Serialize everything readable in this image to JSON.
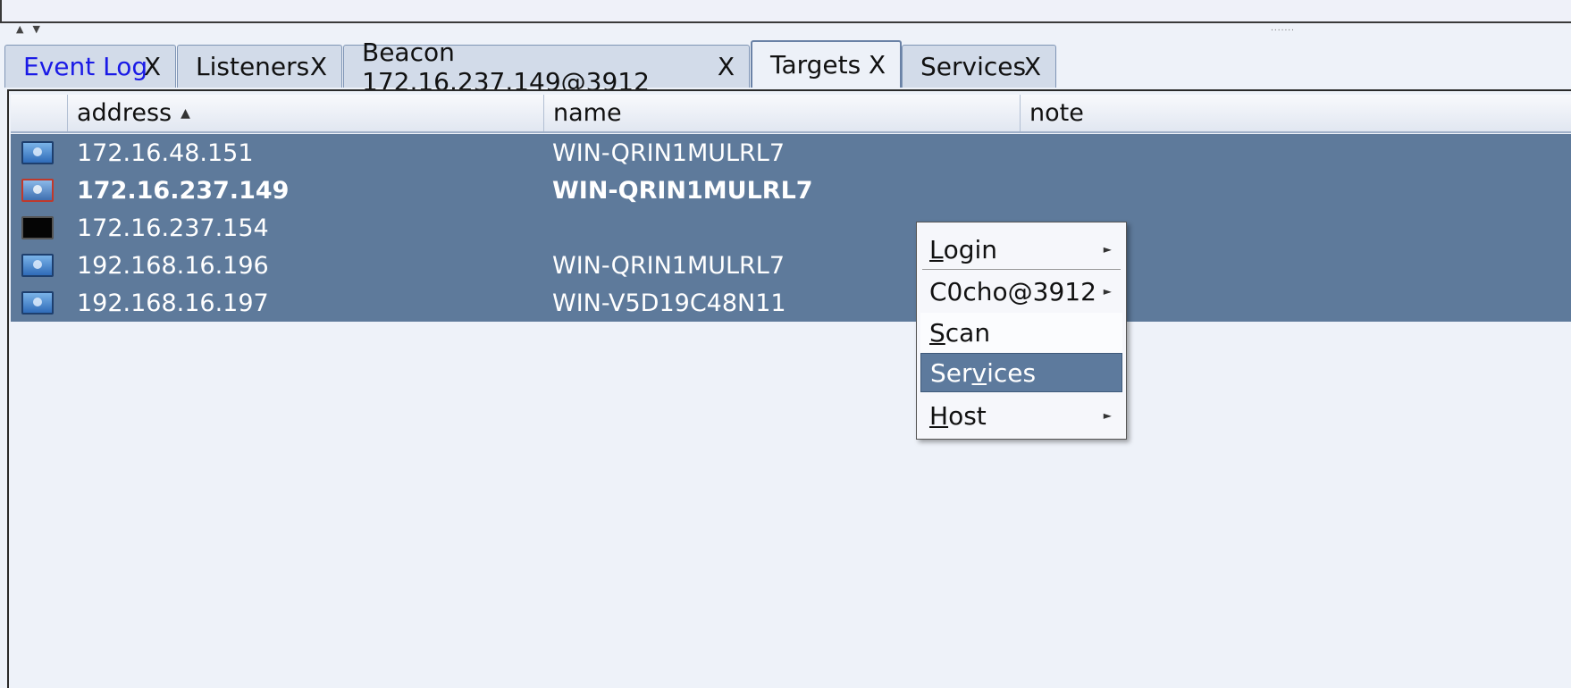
{
  "tabs": [
    {
      "label": "Event Log",
      "close": "X"
    },
    {
      "label": "Listeners",
      "close": "X"
    },
    {
      "label": "Beacon 172.16.237.149@3912",
      "close": "X"
    },
    {
      "label": "Targets",
      "close": "X"
    },
    {
      "label": "Services",
      "close": "X"
    }
  ],
  "table": {
    "columns": [
      "address",
      "name",
      "note"
    ],
    "sort_indicator": "▲",
    "rows": [
      {
        "address": "172.16.48.151",
        "name": "WIN-QRIN1MULRL7",
        "note": "",
        "icon": "windows-host-icon"
      },
      {
        "address": "172.16.237.149",
        "name": "WIN-QRIN1MULRL7",
        "note": "",
        "icon": "windows-host-compromised-icon"
      },
      {
        "address": "172.16.237.154",
        "name": "",
        "note": "",
        "icon": "unknown-host-icon"
      },
      {
        "address": "192.168.16.196",
        "name": "WIN-QRIN1MULRL7",
        "note": "",
        "icon": "windows-host-icon"
      },
      {
        "address": "192.168.16.197",
        "name": "WIN-V5D19C48N11",
        "note": "",
        "icon": "windows-host-icon"
      }
    ]
  },
  "context_menu": {
    "items": [
      {
        "mnemonic": "L",
        "rest": "ogin",
        "submenu": true
      },
      {
        "label": "C0cho@3912",
        "submenu": true
      },
      {
        "mnemonic": "S",
        "rest": "can",
        "submenu": false
      },
      {
        "before": "Ser",
        "mnemonic": "v",
        "rest": "ices",
        "submenu": false,
        "selected": true
      },
      {
        "mnemonic": "H",
        "rest": "ost",
        "submenu": true
      }
    ],
    "submenu_arrow": "►"
  },
  "splitter": {
    "arrows": "▲▼",
    "grip": "......."
  }
}
